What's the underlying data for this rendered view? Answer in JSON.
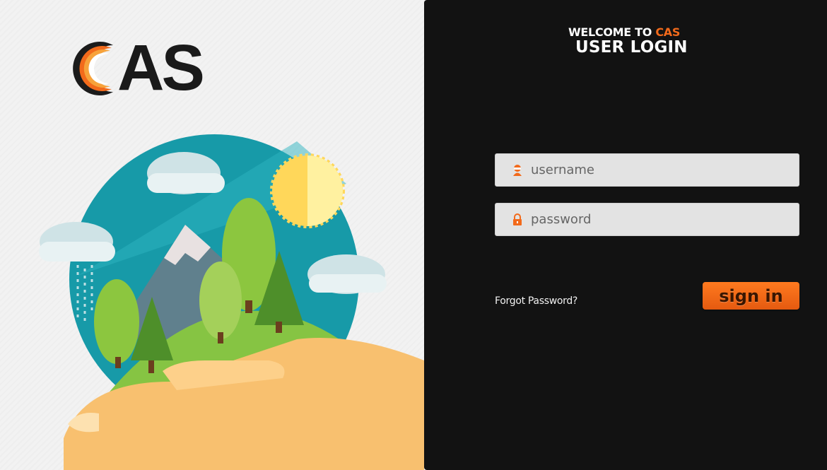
{
  "logo": {
    "text": "AS"
  },
  "header": {
    "welcome_prefix": "WELCOME TO",
    "welcome_brand": "CAS",
    "title": "USER LOGIN"
  },
  "form": {
    "username_placeholder": "username",
    "password_placeholder": "password",
    "forgot_label": "Forgot Password?",
    "signin_label": "sign in"
  },
  "colors": {
    "accent": "#f26a1b",
    "panel_bg": "#121212",
    "field_bg": "#e3e3e3"
  },
  "icons": {
    "username": "user-icon",
    "password": "lock-icon"
  }
}
